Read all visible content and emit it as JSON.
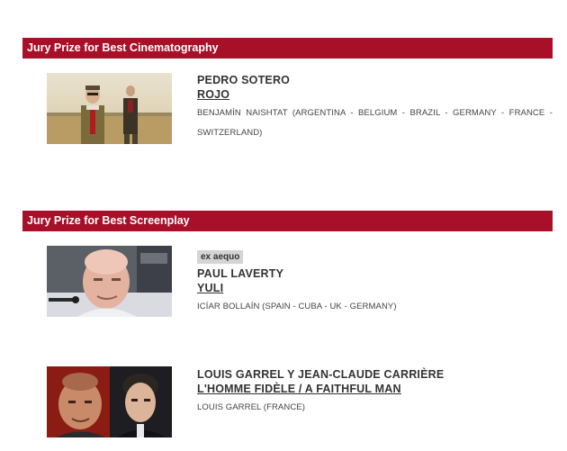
{
  "sections": [
    {
      "title": "Jury Prize for Best Cinematography",
      "awards": [
        {
          "badge": "",
          "winner": "PEDRO SOTERO",
          "film": "ROJO",
          "credits": "BENJAMÍN NAISHTAT (ARGENTINA - BELGIUM - BRAZIL - GERMANY - FRANCE - SWITZERLAND)"
        }
      ]
    },
    {
      "title": "Jury Prize for Best Screenplay",
      "awards": [
        {
          "badge": "ex aequo",
          "winner": "PAUL LAVERTY",
          "film": "YULI",
          "credits": "ICÍAR BOLLAÍN (SPAIN - CUBA - UK - GERMANY)"
        },
        {
          "badge": "",
          "winner": "LOUIS GARREL Y JEAN-CLAUDE CARRIÈRE",
          "film": "L'HOMME FIDÈLE / A FAITHFUL MAN",
          "credits": "LOUIS GARREL (FRANCE)"
        }
      ]
    }
  ],
  "colors": {
    "header_bg": "#a8102a",
    "header_text": "#ffffff",
    "badge_bg": "#d4d4d4",
    "text": "#333333"
  }
}
